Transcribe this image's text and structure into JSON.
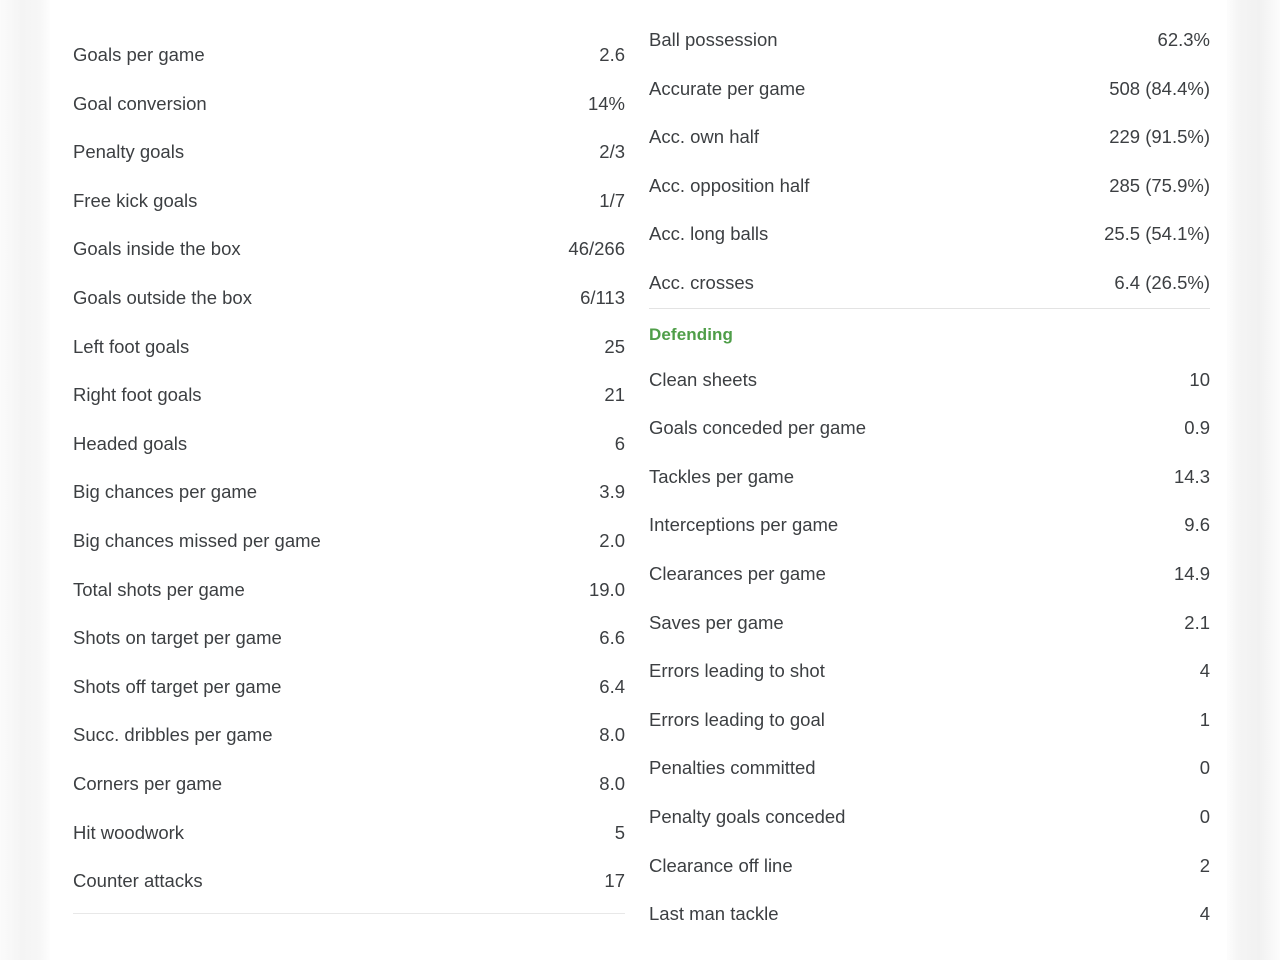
{
  "left_column": {
    "name": "attacking-stats",
    "rows": [
      {
        "label": "Goals per game",
        "value": "2.6"
      },
      {
        "label": "Goal conversion",
        "value": "14%"
      },
      {
        "label": "Penalty goals",
        "value": "2/3"
      },
      {
        "label": "Free kick goals",
        "value": "1/7"
      },
      {
        "label": "Goals inside the box",
        "value": "46/266"
      },
      {
        "label": "Goals outside the box",
        "value": "6/113"
      },
      {
        "label": "Left foot goals",
        "value": "25"
      },
      {
        "label": "Right foot goals",
        "value": "21"
      },
      {
        "label": "Headed goals",
        "value": "6"
      },
      {
        "label": "Big chances per game",
        "value": "3.9"
      },
      {
        "label": "Big chances missed per game",
        "value": "2.0"
      },
      {
        "label": "Total shots per game",
        "value": "19.0"
      },
      {
        "label": "Shots on target per game",
        "value": "6.6"
      },
      {
        "label": "Shots off target per game",
        "value": "6.4"
      },
      {
        "label": "Succ. dribbles per game",
        "value": "8.0"
      },
      {
        "label": "Corners per game",
        "value": "8.0"
      },
      {
        "label": "Hit woodwork",
        "value": "5"
      },
      {
        "label": "Counter attacks",
        "value": "17"
      }
    ]
  },
  "right_column": {
    "passing_section": {
      "name": "passing-stats",
      "rows": [
        {
          "label": "Ball possession",
          "value": "62.3%"
        },
        {
          "label": "Accurate per game",
          "value": "508 (84.4%)"
        },
        {
          "label": "Acc. own half",
          "value": "229 (91.5%)"
        },
        {
          "label": "Acc. opposition half",
          "value": "285 (75.9%)"
        },
        {
          "label": "Acc. long balls",
          "value": "25.5 (54.1%)"
        },
        {
          "label": "Acc. crosses",
          "value": "6.4 (26.5%)"
        }
      ]
    },
    "defending_section": {
      "title": "Defending",
      "title_color": "#4f9e49",
      "rows": [
        {
          "label": "Clean sheets",
          "value": "10"
        },
        {
          "label": "Goals conceded per game",
          "value": "0.9"
        },
        {
          "label": "Tackles per game",
          "value": "14.3"
        },
        {
          "label": "Interceptions per game",
          "value": "9.6"
        },
        {
          "label": "Clearances per game",
          "value": "14.9"
        },
        {
          "label": "Saves per game",
          "value": "2.1"
        },
        {
          "label": "Errors leading to shot",
          "value": "4"
        },
        {
          "label": "Errors leading to goal",
          "value": "1"
        },
        {
          "label": "Penalties committed",
          "value": "0"
        },
        {
          "label": "Penalty goals conceded",
          "value": "0"
        },
        {
          "label": "Clearance off line",
          "value": "2"
        },
        {
          "label": "Last man tackle",
          "value": "4"
        }
      ]
    }
  }
}
